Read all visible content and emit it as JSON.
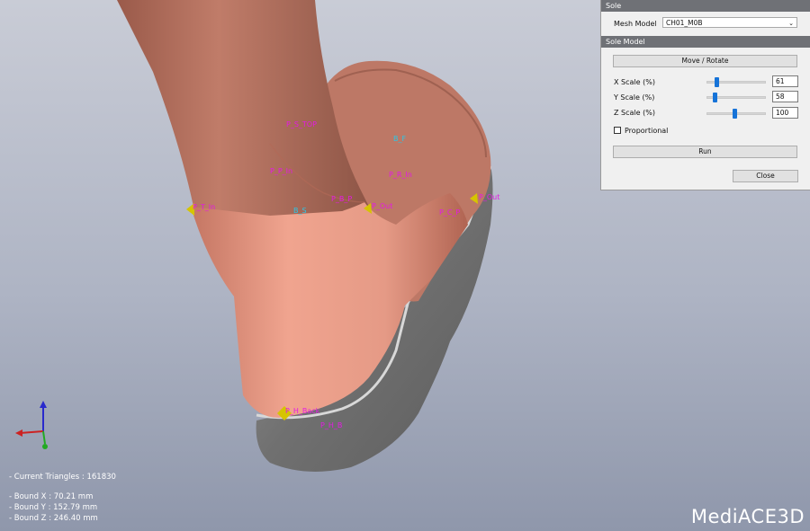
{
  "panel": {
    "title": "Sole",
    "mesh_model_label": "Mesh Model",
    "mesh_model_value": "CH01_M0B",
    "section_title": "Sole Model",
    "move_rotate_label": "Move / Rotate",
    "x_scale": {
      "label": "X Scale (%)",
      "value": "61",
      "slider_fraction": 0.14
    },
    "y_scale": {
      "label": "Y Scale (%)",
      "value": "58",
      "slider_fraction": 0.1
    },
    "z_scale": {
      "label": "Z Scale (%)",
      "value": "100",
      "slider_fraction": 0.47
    },
    "proportional_label": "Proportional",
    "proportional_checked": false,
    "run_label": "Run",
    "close_label": "Close"
  },
  "model_labels": {
    "p_s_top": "P_S_TOP",
    "b_f": "B_F",
    "p_p_in": "P_P_In",
    "p_r_in": "P_R_In",
    "p_t_in": "P_T_In",
    "b_s": "B_S",
    "p_b_p": "P_B_P",
    "p_out": "P_Out",
    "p_f_out": "P_Out",
    "p_c_p": "P_C_P",
    "p_h_back": "P_H_Back",
    "p_h_b": "P_H_B"
  },
  "stats": {
    "triangles": "- Current Triangles : 161830",
    "bound_x": "- Bound X : 70.21 mm",
    "bound_y": "- Bound Y : 152.79 mm",
    "bound_z": "- Bound Z : 246.40 mm"
  },
  "logo": "MediACE3D",
  "colors": {
    "skin": "#d98f7d",
    "sole": "#7d7d7d",
    "marker": "#d6c400",
    "label_magenta": "#e41ae4",
    "label_cyan": "#29c8e8",
    "slider": "#1673d8"
  }
}
